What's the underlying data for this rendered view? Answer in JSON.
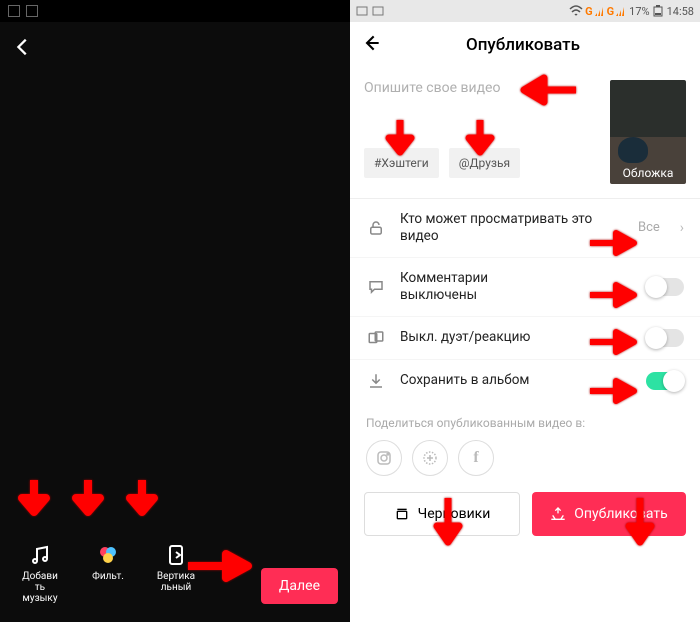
{
  "left": {
    "tools": {
      "music": "Добави\nть\nмузыку",
      "filters": "Фильт.",
      "vertical": "Вертика\nльный"
    },
    "next": "Далее"
  },
  "right": {
    "status": {
      "g1": "G",
      "g2": "G",
      "battery": "17%",
      "time": "14:58"
    },
    "title": "Опубликовать",
    "desc_placeholder": "Опишите свое видео",
    "chips": {
      "hashtags": "#Хэштеги",
      "friends": "@Друзья"
    },
    "cover": "Обложка",
    "rows": {
      "privacy": {
        "label": "Кто может просматривать это видео",
        "value": "Все"
      },
      "comments": {
        "label": "Комментарии\nвыключены"
      },
      "duet": {
        "label": "Выкл. дуэт/реакцию"
      },
      "save": {
        "label": "Сохранить в альбом"
      }
    },
    "share_label": "Поделиться опубликованным видео в:",
    "share_icons": {
      "fb": "f"
    },
    "actions": {
      "drafts": "Черновики",
      "publish": "Опубликовать"
    }
  }
}
